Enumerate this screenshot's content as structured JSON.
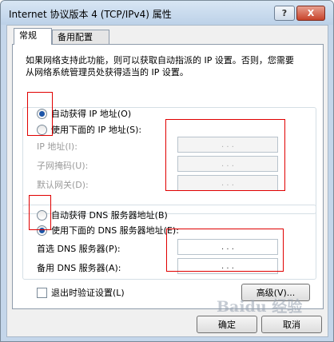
{
  "window": {
    "title": "Internet 协议版本 4 (TCP/IPv4) 属性",
    "help_label": "?",
    "close_label": "X"
  },
  "tabs": [
    {
      "label": "常规"
    },
    {
      "label": "备用配置"
    }
  ],
  "description": "如果网络支持此功能，则可以获取自动指派的 IP 设置。否则，您需要从网络系统管理员处获得适当的 IP 设置。",
  "ip_section": {
    "auto_label": "自动获得 IP 地址(O)",
    "manual_label": "使用下面的 IP 地址(S):",
    "selected": "auto",
    "fields": [
      {
        "label": "IP 地址(I):",
        "value": ".   .   ."
      },
      {
        "label": "子网掩码(U):",
        "value": ".   .   ."
      },
      {
        "label": "默认网关(D):",
        "value": ".   .   ."
      }
    ]
  },
  "dns_section": {
    "auto_label": "自动获得 DNS 服务器地址(B)",
    "manual_label": "使用下面的 DNS 服务器地址(E):",
    "selected": "manual",
    "fields": [
      {
        "label": "首选 DNS 服务器(P):",
        "value": ".   .   ."
      },
      {
        "label": "备用 DNS 服务器(A):",
        "value": ".   .   ."
      }
    ]
  },
  "validate_checkbox": {
    "label": "退出时验证设置(L)",
    "checked": false
  },
  "advanced_button": "高级(V)...",
  "ok_button": "确定",
  "cancel_button": "取消",
  "watermark": "Baidu 经验",
  "colors": {
    "annotation": "#e00000",
    "radio_selected": "#1c55a8"
  }
}
